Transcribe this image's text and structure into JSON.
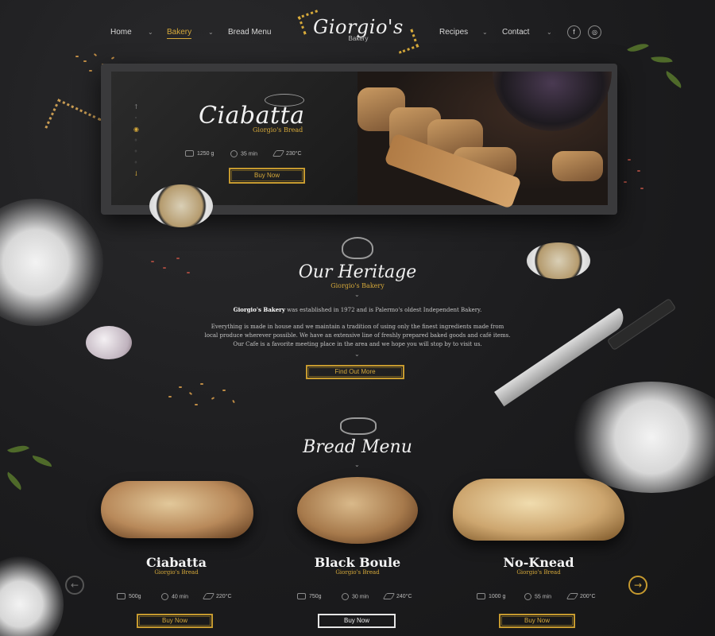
{
  "nav": {
    "items": [
      {
        "label": "Home",
        "has_dropdown": true
      },
      {
        "label": "Bakery",
        "has_dropdown": true,
        "active": true
      },
      {
        "label": "Bread Menu",
        "has_dropdown": false
      },
      {
        "label": "Recipes",
        "has_dropdown": true
      },
      {
        "label": "Contact",
        "has_dropdown": true
      }
    ],
    "logo_text": "Giorgio's",
    "logo_sub": "Bakery",
    "social": [
      "facebook-icon",
      "instagram-icon"
    ]
  },
  "hero": {
    "title": "Ciabatta",
    "subtitle_prefix": "Giorgio's",
    "subtitle_highlight": "Bread",
    "weight": "1250 g",
    "time": "35 min",
    "temp": "230°C",
    "button": "Buy Now"
  },
  "heritage": {
    "title": "Our Heritage",
    "subtitle": "Giorgio's Bakery",
    "intro_bold": "Giorgio's Bakery",
    "intro_rest": " was established in 1972 and is Palermo's oldest Independent Bakery.",
    "p1": "Everything is made in house and we maintain a tradition of using only the finest ingredients made from",
    "p2": "local produce wherever possible. We have an extensive line of freshly prepared baked goods and café items.",
    "p3": "Our Cafe is a favorite meeting place in the area and we hope you will stop by to visit us.",
    "button": "Find Out More"
  },
  "menu": {
    "title": "Bread Menu",
    "cards": [
      {
        "name": "Ciabatta",
        "sub_prefix": "Giorgio's",
        "sub_highlight": "Bread",
        "weight": "500g",
        "time": "40 min",
        "temp": "220°C",
        "button": "Buy Now"
      },
      {
        "name": "Black Boule",
        "sub_prefix": "Giorgio's",
        "sub_highlight": "Bread",
        "weight": "750g",
        "time": "30 min",
        "temp": "240°C",
        "button": "Buy Now"
      },
      {
        "name": "No-Knead",
        "sub_prefix": "Giorgio's",
        "sub_highlight": "Bread",
        "weight": "1000 g",
        "time": "55 min",
        "temp": "200°C",
        "button": "Buy Now"
      }
    ]
  },
  "colors": {
    "accent": "#d6a93a",
    "background": "#1d1d1f",
    "text": "#cfcfcf"
  }
}
